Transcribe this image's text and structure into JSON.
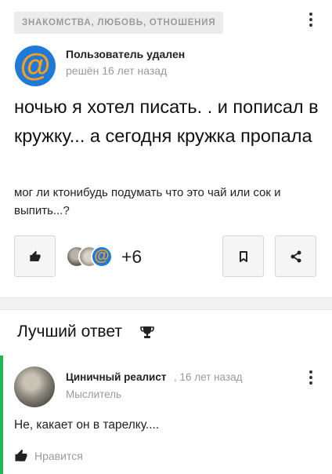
{
  "question": {
    "category": "ЗНАКОМСТВА, ЛЮБОВЬ, ОТНОШЕНИЯ",
    "author": {
      "name": "Пользователь удален",
      "meta": "решён 16 лет назад",
      "avatar_icon": "mail-ru-at-icon"
    },
    "title": "ночью я хотел писать. . и пописал в кружку... а сегодня кружка пропала",
    "text": "мог ли ктонибудь подумать что это чай или сок и выпить...?",
    "likes_extra": "+6",
    "icons": {
      "like": "thumbs-up-icon",
      "bookmark": "bookmark-icon",
      "share": "share-icon",
      "menu": "kebab-menu-icon"
    }
  },
  "best_answer": {
    "heading": "Лучший ответ",
    "heading_icon": "trophy-icon",
    "author": {
      "name": "Циничный реалист",
      "date": ", 16 лет назад",
      "rank": "Мыслитель"
    },
    "text": "Не, какает он в тарелку....",
    "helpful_label": "Нравится",
    "accent_color": "#1db954"
  },
  "colors": {
    "brand_blue": "#1e7ad6",
    "brand_orange": "#ff9e1b",
    "muted_text": "#9a9a9a"
  }
}
